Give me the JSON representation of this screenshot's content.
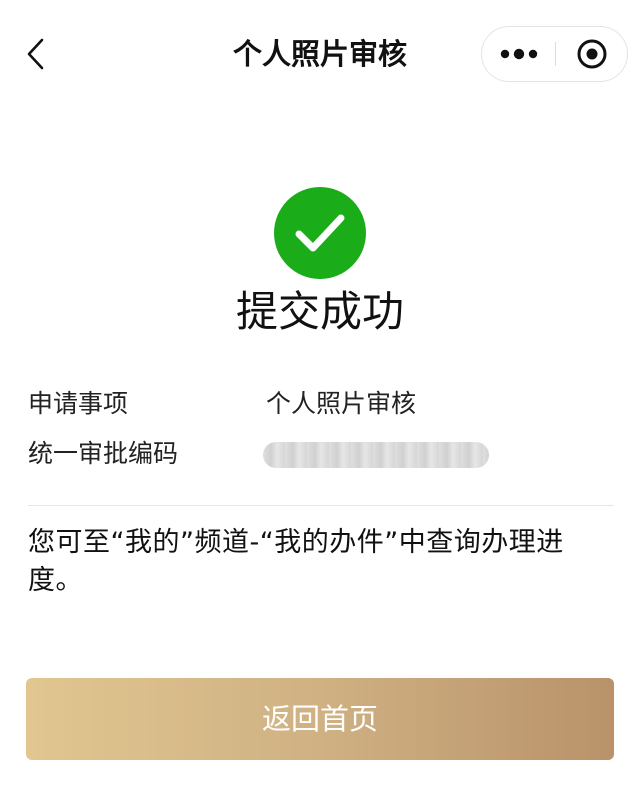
{
  "nav": {
    "title": "个人照片审核",
    "back_icon": "chevron-left-icon",
    "more_icon": "more-dots-icon",
    "close_icon": "target-circle-icon"
  },
  "result": {
    "icon": "check-circle-icon",
    "icon_color": "#1aad19",
    "title": "提交成功"
  },
  "info": {
    "rows": [
      {
        "label": "申请事项",
        "value": "个人照片审核"
      },
      {
        "label": "统一审批编码",
        "value": ""
      }
    ]
  },
  "notice": "您可至“我的”频道-“我的办件”中查询办理进度。",
  "button": {
    "label": "返回首页",
    "gradient_start": "#e1c690",
    "gradient_end": "#b9926a"
  }
}
